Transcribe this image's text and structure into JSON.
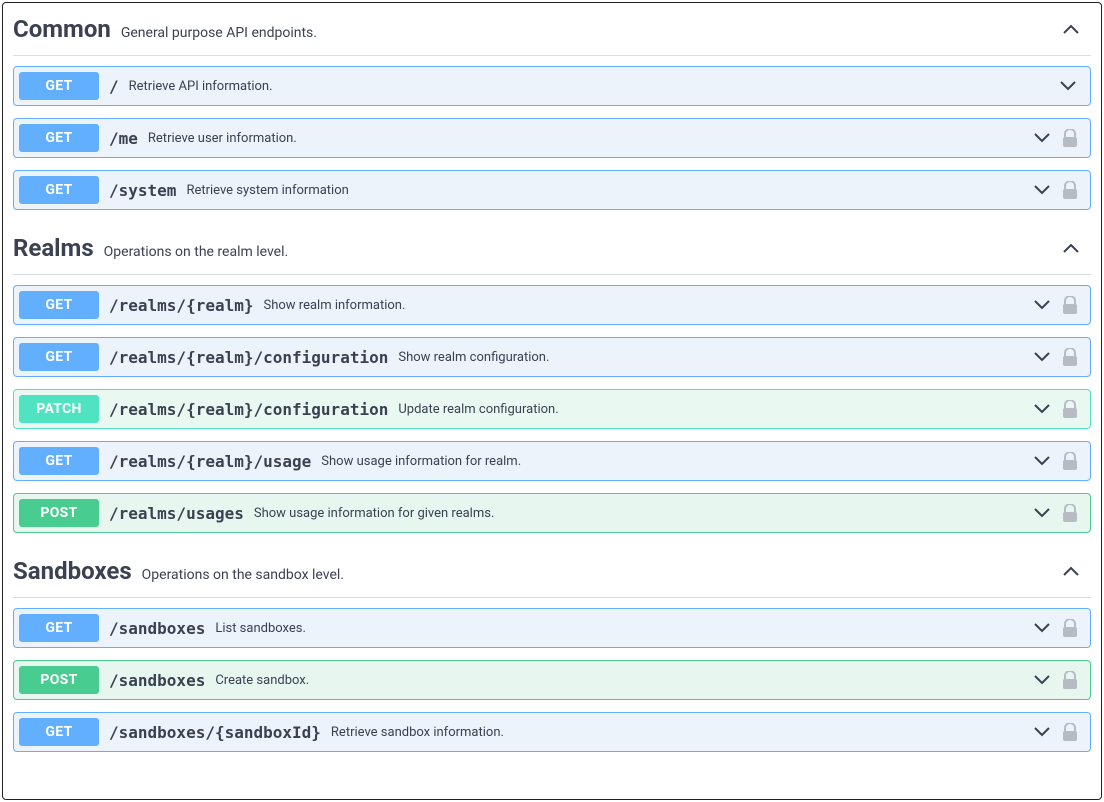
{
  "sections": [
    {
      "name": "Common",
      "desc": "General purpose API endpoints.",
      "expanded": true,
      "ops": [
        {
          "method": "GET",
          "path": "/",
          "summary": "Retrieve API information.",
          "lock": false
        },
        {
          "method": "GET",
          "path": "/me",
          "summary": "Retrieve user information.",
          "lock": true
        },
        {
          "method": "GET",
          "path": "/system",
          "summary": "Retrieve system information",
          "lock": true
        }
      ]
    },
    {
      "name": "Realms",
      "desc": "Operations on the realm level.",
      "expanded": true,
      "ops": [
        {
          "method": "GET",
          "path": "/realms/{realm}",
          "summary": "Show realm information.",
          "lock": true
        },
        {
          "method": "GET",
          "path": "/realms/{realm}/configuration",
          "summary": "Show realm configuration.",
          "lock": true
        },
        {
          "method": "PATCH",
          "path": "/realms/{realm}/configuration",
          "summary": "Update realm configuration.",
          "lock": true
        },
        {
          "method": "GET",
          "path": "/realms/{realm}/usage",
          "summary": "Show usage information for realm.",
          "lock": true
        },
        {
          "method": "POST",
          "path": "/realms/usages",
          "summary": "Show usage information for given realms.",
          "lock": true
        }
      ]
    },
    {
      "name": "Sandboxes",
      "desc": "Operations on the sandbox level.",
      "expanded": true,
      "ops": [
        {
          "method": "GET",
          "path": "/sandboxes",
          "summary": "List sandboxes.",
          "lock": true
        },
        {
          "method": "POST",
          "path": "/sandboxes",
          "summary": "Create sandbox.",
          "lock": true
        },
        {
          "method": "GET",
          "path": "/sandboxes/{sandboxId}",
          "summary": "Retrieve sandbox information.",
          "lock": true
        }
      ]
    }
  ]
}
